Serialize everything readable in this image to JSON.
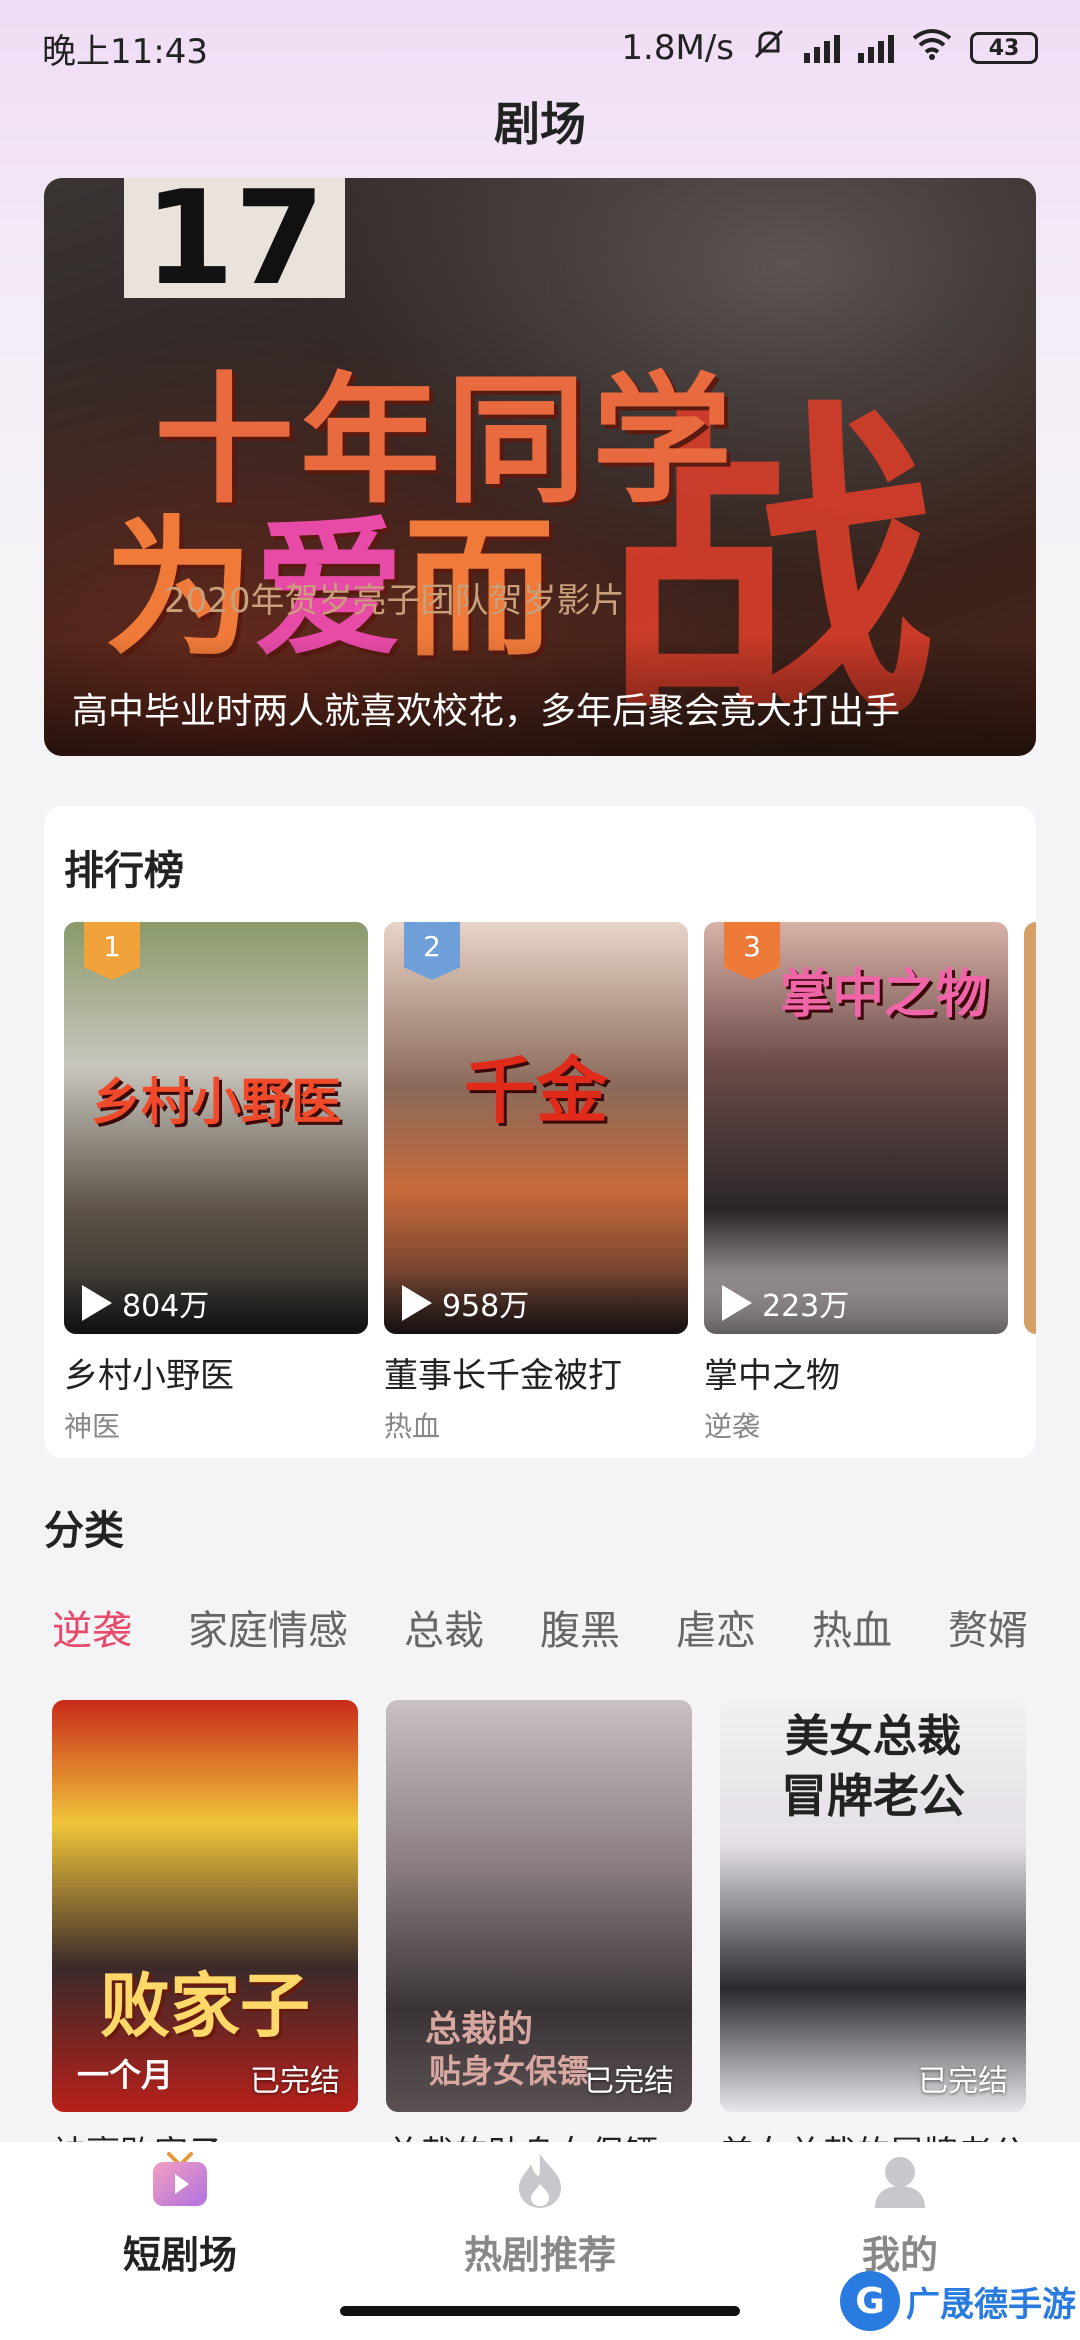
{
  "status_bar": {
    "time": "晚上11:43",
    "net_speed": "1.8M/s",
    "battery": "43"
  },
  "header": {
    "title": "剧场"
  },
  "banner": {
    "overlay_number": "17",
    "art_line1": "十年同学",
    "art_line2_a": "为",
    "art_line2_b": "爱",
    "art_line2_c": "而",
    "art_big": "战",
    "art_subline": "2020年贺岁亮子团队贺岁影片",
    "caption": "高中毕业时两人就喜欢校花，多年后聚会竟大打出手"
  },
  "ranking": {
    "title": "排行榜",
    "items": [
      {
        "rank": "1",
        "name": "乡村小野医",
        "tag": "神医",
        "views": "804万",
        "art": "乡村小野医",
        "badge_color": "#f2a23a"
      },
      {
        "rank": "2",
        "name": "董事长千金被打",
        "tag": "热血",
        "views": "958万",
        "art": "千金",
        "badge_color": "#6f9fd8"
      },
      {
        "rank": "3",
        "name": "掌中之物",
        "tag": "逆袭",
        "views": "223万",
        "art": "掌中之物",
        "badge_color": "#ee7a3a"
      }
    ]
  },
  "category": {
    "title": "分类",
    "tabs": [
      "逆袭",
      "家庭情感",
      "总裁",
      "腹黑",
      "虐恋",
      "热血",
      "赘婿"
    ],
    "active_tab": "逆袭",
    "items": [
      {
        "name": "神豪败家子",
        "status": "已完结",
        "art": "败家子",
        "art_small": "一个月"
      },
      {
        "name": "总裁的贴身女保镖",
        "status": "已完结",
        "art": "总裁的",
        "art_small": "贴身女保镖"
      },
      {
        "name": "美女总裁的冒牌老公",
        "status": "已完结",
        "art": "美女总裁",
        "art_small": "冒牌老公"
      }
    ]
  },
  "bottom_nav": {
    "items": [
      {
        "label": "短剧场",
        "icon": "tv-play-icon",
        "active": true
      },
      {
        "label": "热剧推荐",
        "icon": "flame-icon",
        "active": false
      },
      {
        "label": "我的",
        "icon": "user-icon",
        "active": false
      }
    ]
  },
  "watermark": {
    "text": "广晟德手游"
  },
  "colors": {
    "accent": "#e84a6a",
    "brand_gradient_top": "#efdcf5"
  }
}
